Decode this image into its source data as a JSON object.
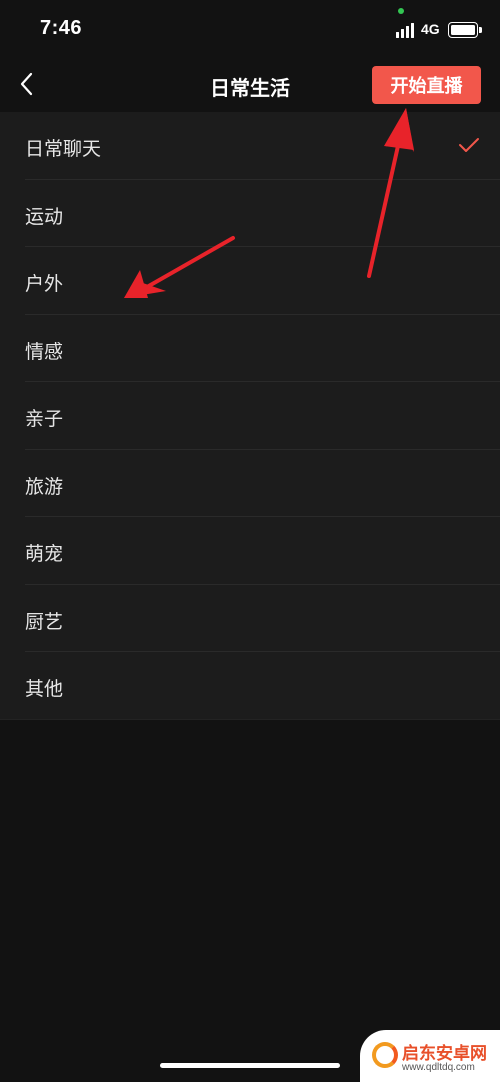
{
  "status_bar": {
    "time": "7:46",
    "network": "4G"
  },
  "nav": {
    "title": "日常生活",
    "start_button": "开始直播"
  },
  "categories": [
    {
      "label": "日常聊天",
      "selected": true
    },
    {
      "label": "运动",
      "selected": false
    },
    {
      "label": "户外",
      "selected": false
    },
    {
      "label": "情感",
      "selected": false
    },
    {
      "label": "亲子",
      "selected": false
    },
    {
      "label": "旅游",
      "selected": false
    },
    {
      "label": "萌宠",
      "selected": false
    },
    {
      "label": "厨艺",
      "selected": false
    },
    {
      "label": "其他",
      "selected": false
    }
  ],
  "watermark": {
    "title": "启东安卓网",
    "url": "www.qdltdq.com"
  },
  "colors": {
    "accent": "#f2574b",
    "background": "#121212",
    "list_background": "#1c1c1c",
    "annotation_arrow": "#e8232a"
  },
  "icons": [
    "back-arrow-icon",
    "check-icon",
    "signal-icon",
    "battery-icon"
  ]
}
